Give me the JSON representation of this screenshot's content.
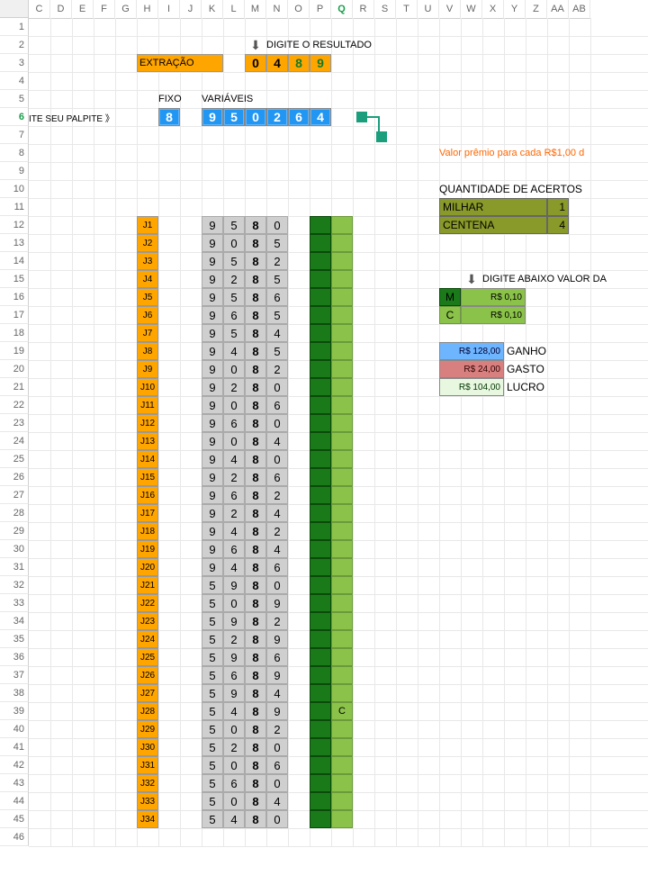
{
  "cols": [
    {
      "l": "C",
      "w": 24
    },
    {
      "l": "D",
      "w": 24
    },
    {
      "l": "E",
      "w": 24
    },
    {
      "l": "F",
      "w": 24
    },
    {
      "l": "G",
      "w": 24
    },
    {
      "l": "H",
      "w": 24
    },
    {
      "l": "I",
      "w": 24
    },
    {
      "l": "J",
      "w": 24
    },
    {
      "l": "K",
      "w": 24
    },
    {
      "l": "L",
      "w": 24
    },
    {
      "l": "M",
      "w": 24
    },
    {
      "l": "N",
      "w": 24
    },
    {
      "l": "O",
      "w": 24
    },
    {
      "l": "P",
      "w": 24
    },
    {
      "l": "Q",
      "w": 24
    },
    {
      "l": "R",
      "w": 24
    },
    {
      "l": "S",
      "w": 24
    },
    {
      "l": "T",
      "w": 24
    },
    {
      "l": "U",
      "w": 24
    },
    {
      "l": "V",
      "w": 24
    },
    {
      "l": "W",
      "w": 24
    },
    {
      "l": "X",
      "w": 24
    },
    {
      "l": "Y",
      "w": 24
    },
    {
      "l": "Z",
      "w": 24
    },
    {
      "l": "AA",
      "w": 24
    },
    {
      "l": "AB",
      "w": 24
    }
  ],
  "activeCol": "Q",
  "activeRow": 6,
  "rowMax": 46,
  "headers": {
    "digite": "DIGITE O RESULTADO",
    "extracao": "EXTRAÇÃO",
    "fixo": "FIXO",
    "variaveis": "VARIÁVEIS",
    "palpite": "ITE SEU PALPITE 》",
    "premio": "Valor prêmio para cada R$1,00 d",
    "acertos": "QUANTIDADE DE ACERTOS",
    "milhar": "MILHAR",
    "centena": "CENTENA",
    "digite2": "DIGITE ABAIXO VALOR DA",
    "ganho": "GANHO",
    "gasto": "GASTO",
    "lucro": "LUCRO"
  },
  "resultado": [
    "0",
    "4",
    "8",
    "9"
  ],
  "fixo": "8",
  "variaveis": [
    "9",
    "5",
    "0",
    "2",
    "6",
    "4"
  ],
  "acertos": {
    "milhar": "1",
    "centena": "4"
  },
  "aposta": {
    "m_lbl": "M",
    "c_lbl": "C",
    "m_val": "R$ 0,10",
    "c_val": "R$ 0,10"
  },
  "money": {
    "ganho": "R$ 128,00",
    "gasto": "R$ 24,00",
    "lucro": "R$ 104,00"
  },
  "combos": [
    {
      "j": "J1",
      "v": [
        "9",
        "5",
        "8",
        "0"
      ],
      "mark": ""
    },
    {
      "j": "J2",
      "v": [
        "9",
        "0",
        "8",
        "5"
      ],
      "mark": ""
    },
    {
      "j": "J3",
      "v": [
        "9",
        "5",
        "8",
        "2"
      ],
      "mark": ""
    },
    {
      "j": "J4",
      "v": [
        "9",
        "2",
        "8",
        "5"
      ],
      "mark": ""
    },
    {
      "j": "J5",
      "v": [
        "9",
        "5",
        "8",
        "6"
      ],
      "mark": ""
    },
    {
      "j": "J6",
      "v": [
        "9",
        "6",
        "8",
        "5"
      ],
      "mark": ""
    },
    {
      "j": "J7",
      "v": [
        "9",
        "5",
        "8",
        "4"
      ],
      "mark": ""
    },
    {
      "j": "J8",
      "v": [
        "9",
        "4",
        "8",
        "5"
      ],
      "mark": ""
    },
    {
      "j": "J9",
      "v": [
        "9",
        "0",
        "8",
        "2"
      ],
      "mark": ""
    },
    {
      "j": "J10",
      "v": [
        "9",
        "2",
        "8",
        "0"
      ],
      "mark": ""
    },
    {
      "j": "J11",
      "v": [
        "9",
        "0",
        "8",
        "6"
      ],
      "mark": ""
    },
    {
      "j": "J12",
      "v": [
        "9",
        "6",
        "8",
        "0"
      ],
      "mark": ""
    },
    {
      "j": "J13",
      "v": [
        "9",
        "0",
        "8",
        "4"
      ],
      "mark": ""
    },
    {
      "j": "J14",
      "v": [
        "9",
        "4",
        "8",
        "0"
      ],
      "mark": ""
    },
    {
      "j": "J15",
      "v": [
        "9",
        "2",
        "8",
        "6"
      ],
      "mark": ""
    },
    {
      "j": "J16",
      "v": [
        "9",
        "6",
        "8",
        "2"
      ],
      "mark": ""
    },
    {
      "j": "J17",
      "v": [
        "9",
        "2",
        "8",
        "4"
      ],
      "mark": ""
    },
    {
      "j": "J18",
      "v": [
        "9",
        "4",
        "8",
        "2"
      ],
      "mark": ""
    },
    {
      "j": "J19",
      "v": [
        "9",
        "6",
        "8",
        "4"
      ],
      "mark": ""
    },
    {
      "j": "J20",
      "v": [
        "9",
        "4",
        "8",
        "6"
      ],
      "mark": ""
    },
    {
      "j": "J21",
      "v": [
        "5",
        "9",
        "8",
        "0"
      ],
      "mark": ""
    },
    {
      "j": "J22",
      "v": [
        "5",
        "0",
        "8",
        "9"
      ],
      "mark": ""
    },
    {
      "j": "J23",
      "v": [
        "5",
        "9",
        "8",
        "2"
      ],
      "mark": ""
    },
    {
      "j": "J24",
      "v": [
        "5",
        "2",
        "8",
        "9"
      ],
      "mark": ""
    },
    {
      "j": "J25",
      "v": [
        "5",
        "9",
        "8",
        "6"
      ],
      "mark": ""
    },
    {
      "j": "J26",
      "v": [
        "5",
        "6",
        "8",
        "9"
      ],
      "mark": ""
    },
    {
      "j": "J27",
      "v": [
        "5",
        "9",
        "8",
        "4"
      ],
      "mark": ""
    },
    {
      "j": "J28",
      "v": [
        "5",
        "4",
        "8",
        "9"
      ],
      "mark": "C"
    },
    {
      "j": "J29",
      "v": [
        "5",
        "0",
        "8",
        "2"
      ],
      "mark": ""
    },
    {
      "j": "J30",
      "v": [
        "5",
        "2",
        "8",
        "0"
      ],
      "mark": ""
    },
    {
      "j": "J31",
      "v": [
        "5",
        "0",
        "8",
        "6"
      ],
      "mark": ""
    },
    {
      "j": "J32",
      "v": [
        "5",
        "6",
        "8",
        "0"
      ],
      "mark": ""
    },
    {
      "j": "J33",
      "v": [
        "5",
        "0",
        "8",
        "4"
      ],
      "mark": ""
    },
    {
      "j": "J34",
      "v": [
        "5",
        "4",
        "8",
        "0"
      ],
      "mark": ""
    }
  ]
}
